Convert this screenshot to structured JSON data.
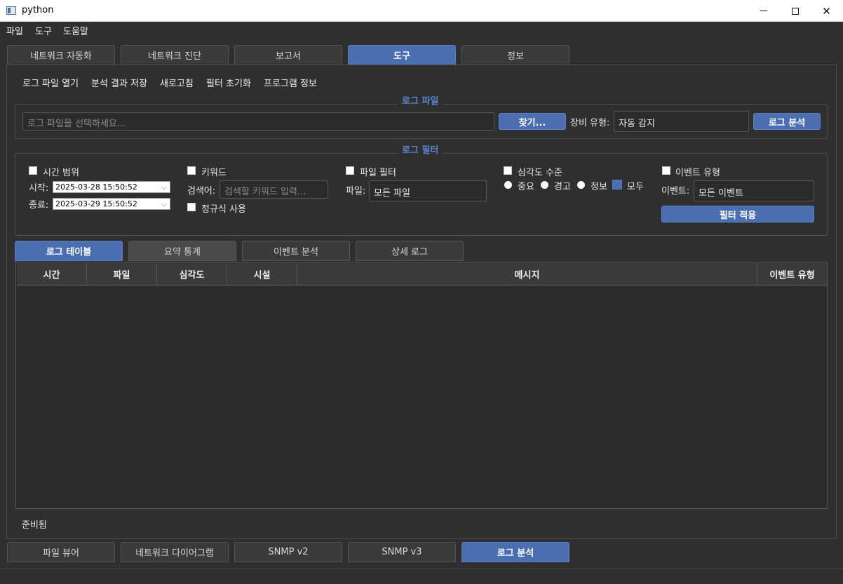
{
  "window": {
    "title": "python"
  },
  "menu": [
    "파일",
    "도구",
    "도움말"
  ],
  "top_tabs": [
    {
      "label": "네트워크 자동화",
      "active": false
    },
    {
      "label": "네트워크 진단",
      "active": false
    },
    {
      "label": "보고서",
      "active": false
    },
    {
      "label": "도구",
      "active": true
    },
    {
      "label": "정보",
      "active": false
    }
  ],
  "toolbar": [
    "로그 파일 열기",
    "분석 결과 저장",
    "새로고침",
    "필터 초기화",
    "프로그램 정보"
  ],
  "log_file": {
    "group_title": "로그 파일",
    "path_placeholder": "로그 파일을 선택하세요...",
    "browse_label": "찾기...",
    "device_type_label": "장비 유형:",
    "device_type_value": "자동 감지",
    "analyze_label": "로그 분석"
  },
  "log_filter": {
    "group_title": "로그 필터",
    "time_range": {
      "check_label": "시간 범위",
      "start_label": "시작:",
      "start_value": "2025-03-28 15:50:52",
      "end_label": "종료:",
      "end_value": "2025-03-29 15:50:52"
    },
    "keyword": {
      "check_label": "키워드",
      "search_label": "검색어:",
      "search_placeholder": "검색할 키워드 입력...",
      "regex_label": "정규식 사용"
    },
    "file_filter": {
      "check_label": "파일 필터",
      "file_label": "파일:",
      "file_value": "모든 파일"
    },
    "severity": {
      "check_label": "심각도 수준",
      "options": [
        "중요",
        "경고",
        "정보",
        "모두"
      ],
      "selected": "모두"
    },
    "event_type": {
      "check_label": "이벤트 유형",
      "event_label": "이벤트:",
      "event_value": "모든 이벤트"
    },
    "apply_label": "필터 적용"
  },
  "result_tabs": [
    {
      "label": "로그 테이블",
      "state": "active"
    },
    {
      "label": "요약 통계",
      "state": "hover"
    },
    {
      "label": "이벤트 분석",
      "state": "normal"
    },
    {
      "label": "상세 로그",
      "state": "normal"
    }
  ],
  "table": {
    "columns": [
      "시간",
      "파일",
      "심각도",
      "시설",
      "메시지",
      "이벤트 유형"
    ],
    "rows": []
  },
  "status_text": "준비됨",
  "bottom_tabs": [
    {
      "label": "파일 뷰어",
      "active": false
    },
    {
      "label": "네트워크 다이어그램",
      "active": false
    },
    {
      "label": "SNMP v2",
      "active": false
    },
    {
      "label": "SNMP v3",
      "active": false
    },
    {
      "label": "로그 분석",
      "active": true
    }
  ],
  "colors": {
    "accent": "#4a6eb0",
    "background": "#2f2f2f",
    "group_title": "#5a86d0"
  }
}
